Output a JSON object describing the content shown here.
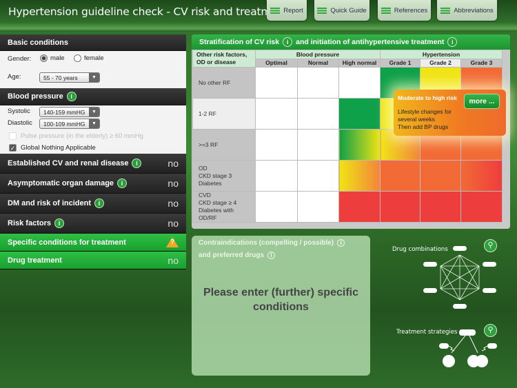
{
  "app": {
    "title": "Hypertension guideline check - CV risk and treatment"
  },
  "tabs": [
    {
      "label": "Report",
      "icon": "menu-icon"
    },
    {
      "label": "Quick Guide",
      "icon": "menu-icon"
    },
    {
      "label": "References",
      "icon": "menu-icon"
    },
    {
      "label": "Abbreviations",
      "icon": "menu-icon"
    }
  ],
  "basic": {
    "title": "Basic conditions",
    "gender_label": "Gender:",
    "male": "male",
    "female": "female",
    "gender_selected": "male",
    "age_label": "Age:",
    "age_value": "55 - 70 years"
  },
  "bp": {
    "title": "Blood pressure",
    "systolic_label": "Systolic",
    "systolic_value": "140-159 mmHG",
    "diastolic_label": "Diastolic",
    "diastolic_value": "100-109 mmHG",
    "pulse_label": "Pulse pressure (in the elderly) ≥ 60 mmHg",
    "pulse_checked": false,
    "global_label": "Global Nothing Applicable",
    "global_checked": true
  },
  "sections": [
    {
      "label": "Established CV and renal disease",
      "info": true,
      "value": "no"
    },
    {
      "label": "Asymptomatic organ damage",
      "info": true,
      "value": "no"
    },
    {
      "label": "DM and risk of incident",
      "info": true,
      "value": "no"
    },
    {
      "label": "Risk factors",
      "info": true,
      "value": "no"
    },
    {
      "label": "Specific conditions for treatment",
      "green": true,
      "value": "?",
      "icon": "warning-icon"
    },
    {
      "label": "Drug treatment",
      "green": true,
      "value": "no"
    }
  ],
  "strat": {
    "title_a": "Stratification of CV risk",
    "title_b": "and initiation of antihypertensive treatment",
    "corner": "Other risk factors, OD or disease",
    "group_bp": "Blood pressure",
    "group_ht": "Hypertension",
    "columns": [
      "Optimal",
      "Normal",
      "High normal",
      "Grade 1",
      "Grade 2",
      "Grade 3"
    ],
    "selected_column": "Grade 2",
    "selected_row": "1-2 RF",
    "rows": [
      {
        "label": "No other RF",
        "cells": [
          "#ffffff",
          "#ffffff",
          "#ffffff",
          "#0fa04a",
          "#f0e414",
          "#f26a35"
        ]
      },
      {
        "label": "1-2 RF",
        "cells": [
          "#ffffff",
          "#ffffff",
          "#0fa04a",
          "#f0e414",
          "#f26a35",
          "#f26a35"
        ]
      },
      {
        "label": ">=3 RF",
        "cells": [
          "#ffffff",
          "#ffffff",
          "linear-gradient(90deg,#0fa04a,#f0e414)",
          "linear-gradient(90deg,#f0e414,#f2853a)",
          "#f26a35",
          "#f26a35"
        ]
      },
      {
        "label": "OD\nCKD stage 3\nDiabetes",
        "cells": [
          "#ffffff",
          "#ffffff",
          "linear-gradient(90deg,#f0e414,#f2853a)",
          "#f26a35",
          "#f26a35",
          "linear-gradient(90deg,#f26a35,#ee3d3d)"
        ]
      },
      {
        "label": "CVD\nCKD stage ≥ 4\nDiabetes with\nOD/RF",
        "cells": [
          "#ffffff",
          "#ffffff",
          "#ee3d3d",
          "#ee3d3d",
          "#ee3d3d",
          "#ee3d3d"
        ]
      }
    ]
  },
  "popup": {
    "title": "Moderate to high risk",
    "line1": "Lifestyle changes for",
    "line2": "several weeks",
    "line3": "Then add BP drugs",
    "more": "more ..."
  },
  "contra": {
    "title1": "Contraindications (compelling / possible)",
    "title2": "and preferred drugs",
    "message": "Please enter (further) specific conditions"
  },
  "diagrams": {
    "drug_combinations": "Drug combinations",
    "treatment_strategies": "Treatment strategies"
  }
}
